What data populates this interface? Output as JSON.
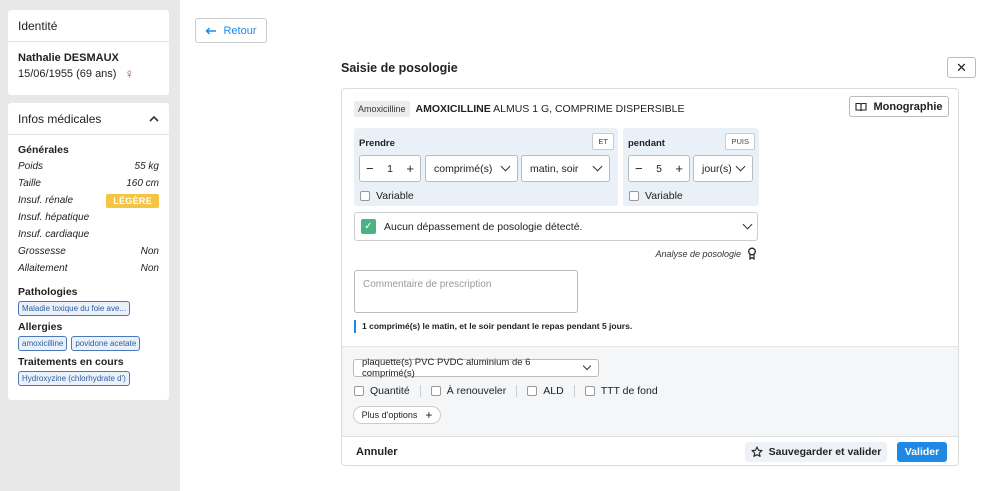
{
  "identity": {
    "header": "Identité",
    "name": "Nathalie DESMAUX",
    "dob": "15/06/1955 (69 ans)",
    "gender_icon": "female-icon"
  },
  "medical": {
    "header": "Infos médicales",
    "general_title": "Générales",
    "rows": [
      {
        "label": "Poids",
        "value": "55 kg"
      },
      {
        "label": "Taille",
        "value": "160 cm"
      },
      {
        "label": "Insuf. rénale",
        "value": "LÉGÈRE"
      },
      {
        "label": "Insuf. hépatique",
        "value": ""
      },
      {
        "label": "Insuf. cardiaque",
        "value": ""
      },
      {
        "label": "Grossesse",
        "value": "Non"
      },
      {
        "label": "Allaitement",
        "value": "Non"
      }
    ],
    "pathologies_title": "Pathologies",
    "pathologies": [
      "Maladie toxique du foie ave..."
    ],
    "allergies_title": "Allergies",
    "allergies": [
      "amoxicilline",
      "povidone acetate"
    ],
    "treatments_title": "Traitements en cours",
    "treatments": [
      "Hydroxyzine (chlorhydrate d')"
    ],
    "badge_color": "#f5c443",
    "chip_color": "#4a79b8"
  },
  "back_button": {
    "label": "Retour"
  },
  "modal": {
    "title": "Saisie de posologie",
    "close": "✕",
    "drug_tag": "Amoxicilline",
    "drug_brand": "AMOXICILLINE",
    "drug_rest": " ALMUS 1 G, COMPRIME DISPERSIBLE",
    "monograph_label": "Monographie",
    "prendre": {
      "label": "Prendre",
      "tag": "ET",
      "quantity": "1",
      "unit": "comprimé(s)",
      "moment": "matin, soir",
      "variable_label": "Variable"
    },
    "pendant": {
      "label": "pendant",
      "tag": "PUIS",
      "quantity": "5",
      "unit": "jour(s)",
      "variable_label": "Variable"
    },
    "check_message": "Aucun dépassement de posologie détecté.",
    "analysis_label": "Analyse de posologie",
    "comment_placeholder": "Commentaire de prescription",
    "summary": "1 comprimé(s) le matin, et le soir pendant le repas pendant 5 jours.",
    "packaging": "plaquette(s) PVC PVDC aluminium de 6 comprimé(s)",
    "options": [
      "Quantité",
      "À renouveler",
      "ALD",
      "TTT de fond"
    ],
    "more_options": "Plus d'options",
    "cancel": "Annuler",
    "save_validate": "Sauvegarder et valider",
    "validate": "Valider",
    "accent_color": "#1e88e5",
    "success_color": "#49b384"
  }
}
